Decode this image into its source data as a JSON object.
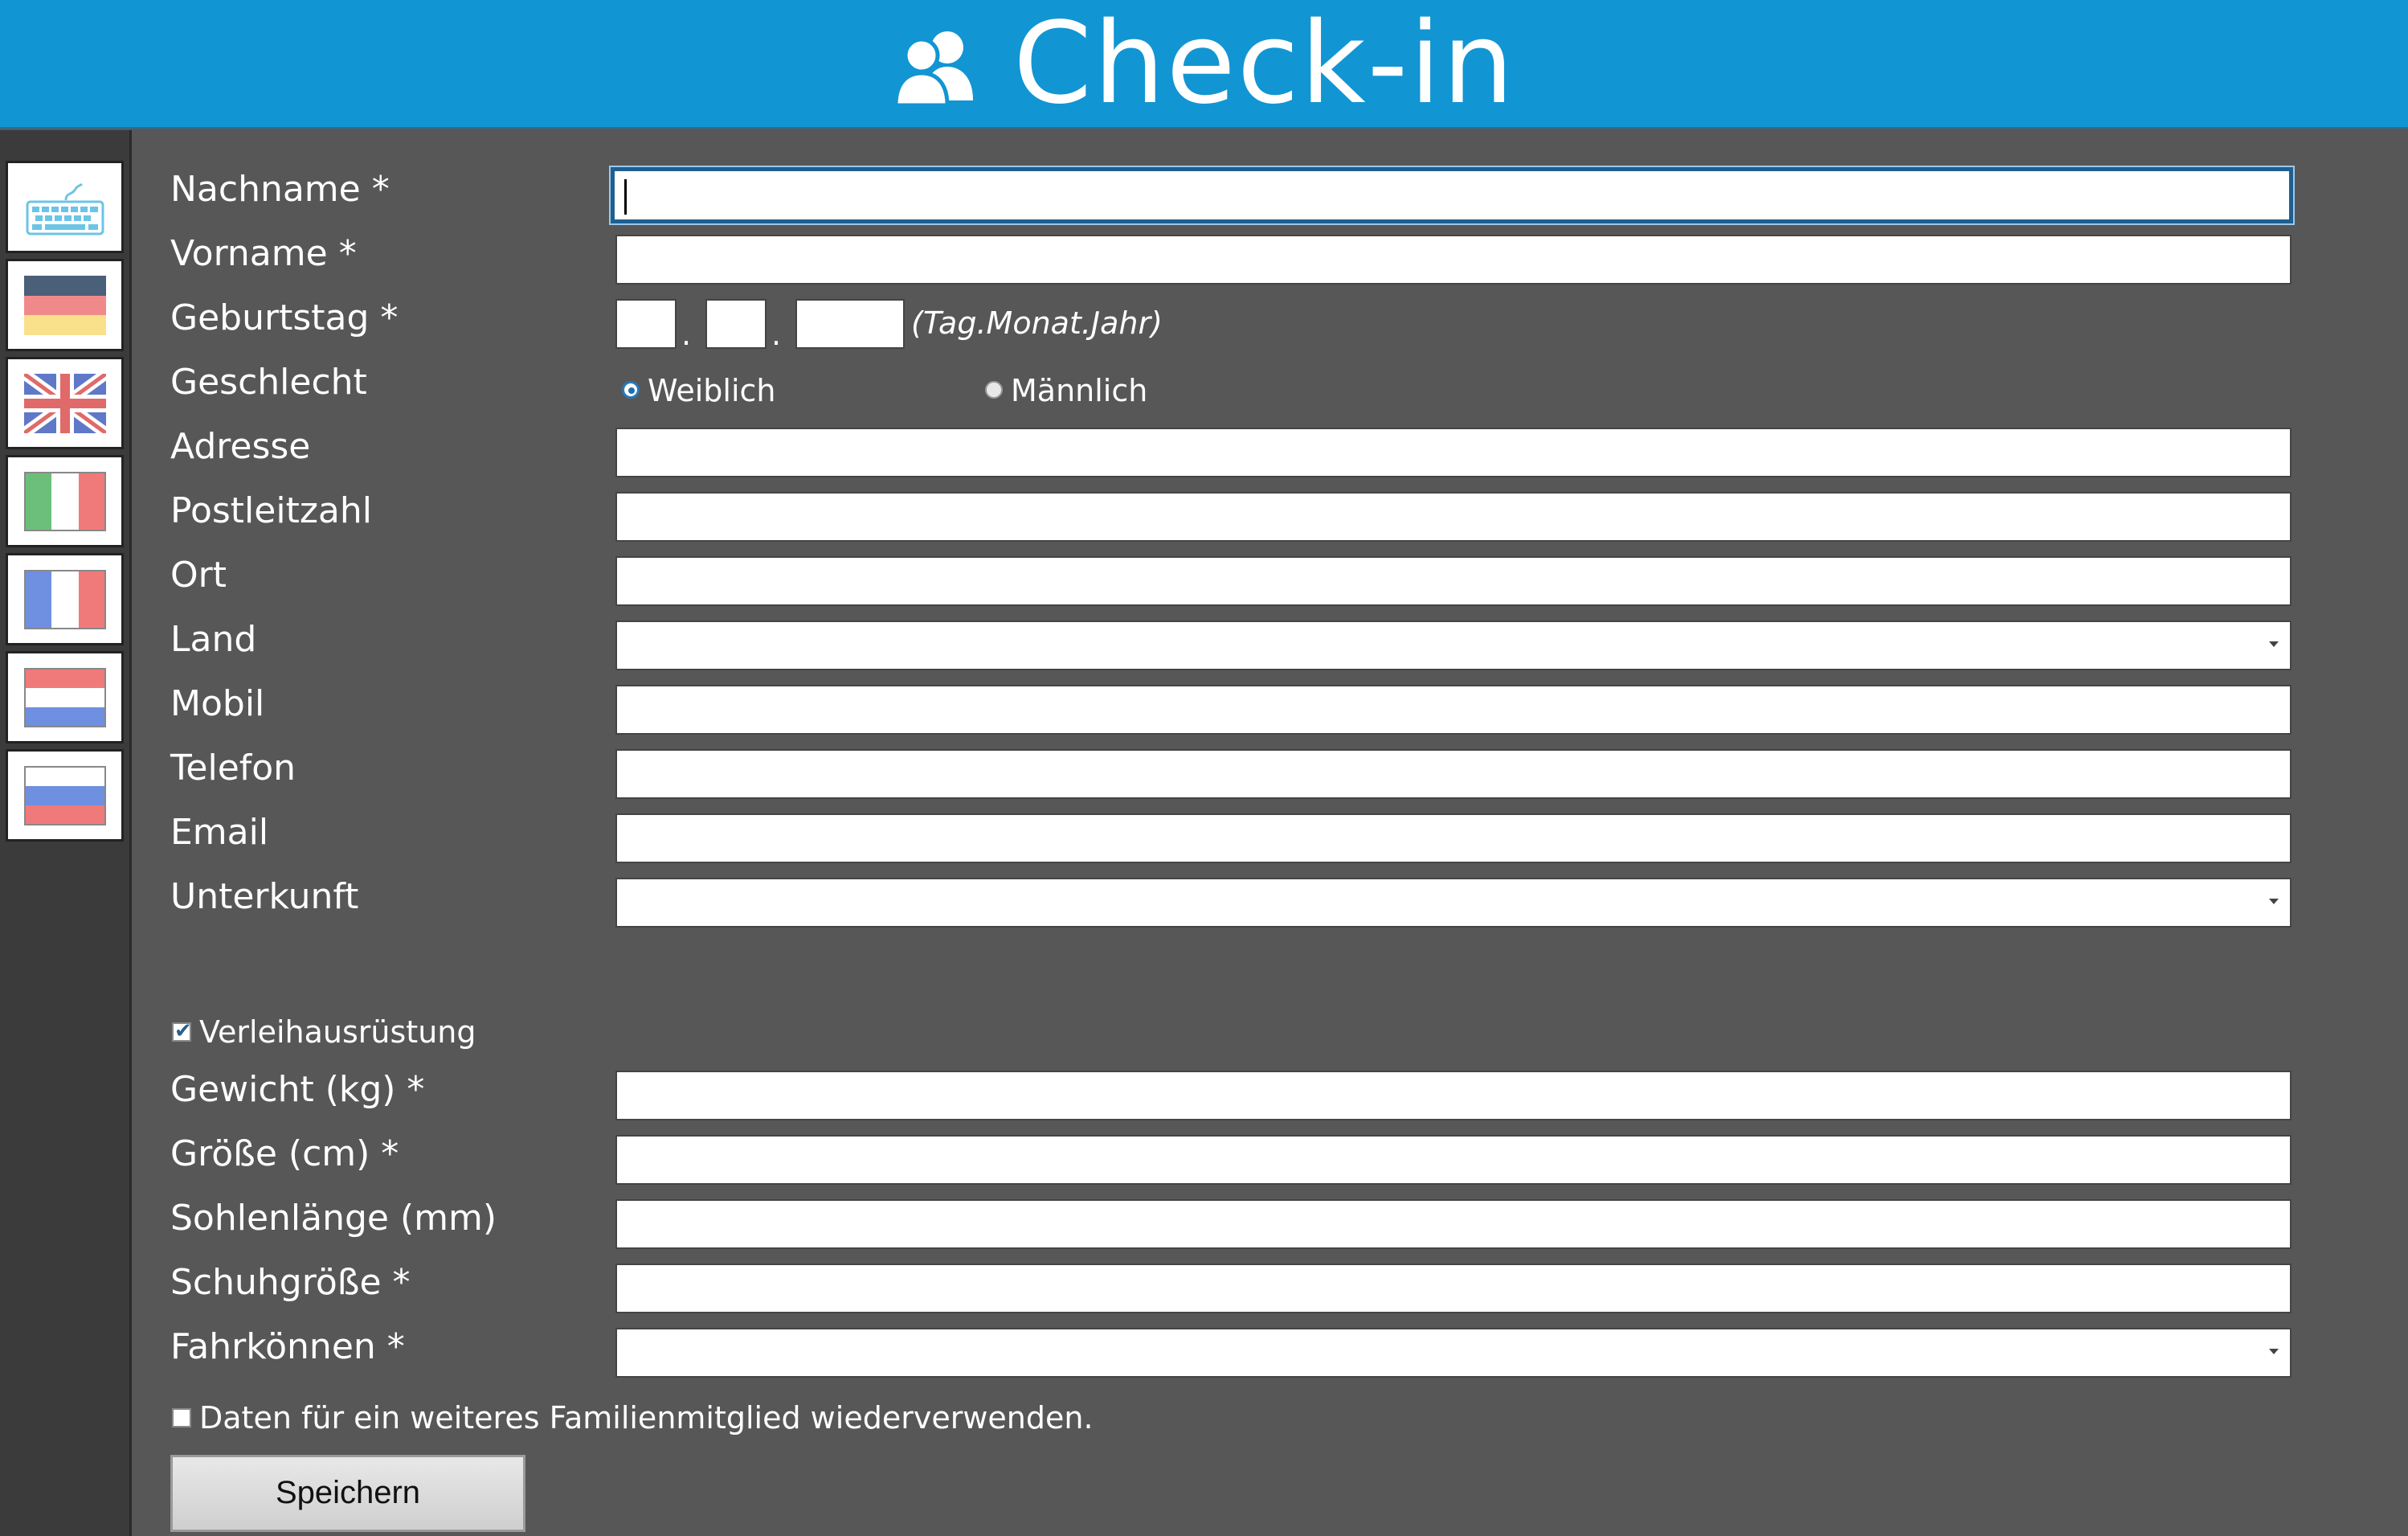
{
  "header": {
    "title": "Check-in",
    "icon": "users-icon"
  },
  "sidebar": {
    "items": [
      {
        "name": "keyboard-icon"
      },
      {
        "name": "flag-germany"
      },
      {
        "name": "flag-uk"
      },
      {
        "name": "flag-italy"
      },
      {
        "name": "flag-france"
      },
      {
        "name": "flag-netherlands"
      },
      {
        "name": "flag-russia"
      }
    ]
  },
  "form": {
    "nachname": {
      "label": "Nachname *",
      "value": ""
    },
    "vorname": {
      "label": "Vorname *",
      "value": ""
    },
    "geburtstag": {
      "label": "Geburtstag *",
      "day": "",
      "month": "",
      "year": "",
      "separator": ".",
      "hint": "(Tag.Monat.Jahr)"
    },
    "geschlecht": {
      "label": "Geschlecht",
      "options": [
        "Weiblich",
        "Männlich"
      ],
      "selected": "Weiblich"
    },
    "adresse": {
      "label": "Adresse",
      "value": ""
    },
    "postleitzahl": {
      "label": "Postleitzahl",
      "value": ""
    },
    "ort": {
      "label": "Ort",
      "value": ""
    },
    "land": {
      "label": "Land",
      "value": ""
    },
    "mobil": {
      "label": "Mobil",
      "value": ""
    },
    "telefon": {
      "label": "Telefon",
      "value": ""
    },
    "email": {
      "label": "Email",
      "value": ""
    },
    "unterkunft": {
      "label": "Unterkunft",
      "value": ""
    },
    "verleih": {
      "label": "Verleihausrüstung",
      "checked": true
    },
    "gewicht": {
      "label": "Gewicht (kg) *",
      "value": ""
    },
    "groesse": {
      "label": "Größe (cm) *",
      "value": ""
    },
    "sohlenlaenge": {
      "label": "Sohlenlänge (mm)",
      "value": ""
    },
    "schuhgroesse": {
      "label": "Schuhgröße *",
      "value": ""
    },
    "fahrkoennen": {
      "label": "Fahrkönnen *",
      "value": ""
    },
    "familie": {
      "label": "Daten für ein weiteres Familienmitglied wiederverwenden.",
      "checked": false
    }
  },
  "actions": {
    "save_label": "Speichern"
  },
  "colors": {
    "header": "#1295d3",
    "background": "#575757",
    "sidebar": "#3b3b3b"
  }
}
